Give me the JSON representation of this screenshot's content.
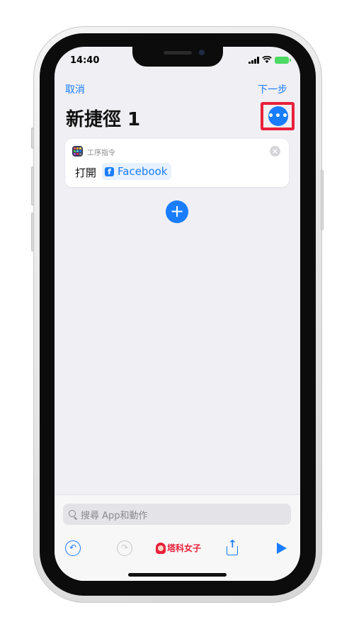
{
  "status_bar": {
    "time": "14:40"
  },
  "nav": {
    "cancel_label": "取消",
    "next_label": "下一步"
  },
  "page": {
    "title": "新捷徑 1"
  },
  "more_button": {
    "glyph": "•••"
  },
  "action_card": {
    "app_name": "工序指令",
    "close_glyph": "×",
    "action_label": "打開",
    "parameter": {
      "icon_glyph": "f",
      "label": "Facebook"
    }
  },
  "add_action": {
    "glyph": "+"
  },
  "search": {
    "placeholder": "搜尋 App和動作"
  },
  "toolbar": {
    "undo_glyph": "↶",
    "redo_glyph": "↷",
    "logo_text": "塔科女子"
  },
  "colors": {
    "accent": "#1a7dff",
    "highlight": "#e8203a",
    "background": "#efeff4"
  }
}
